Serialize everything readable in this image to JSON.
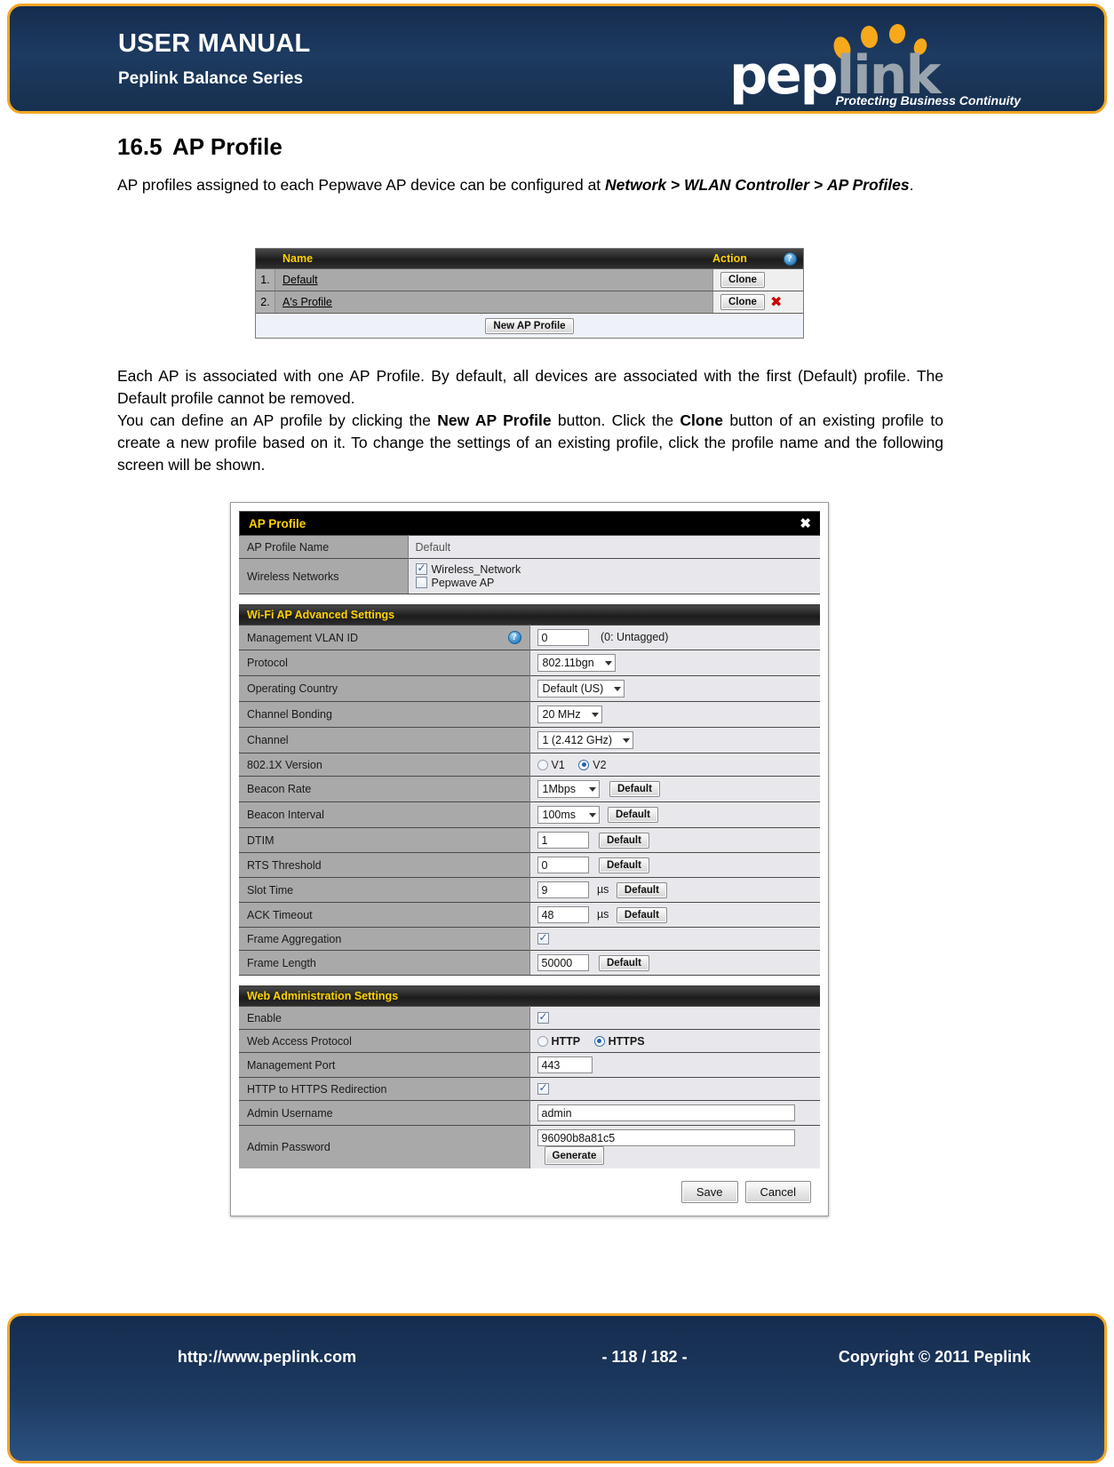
{
  "header": {
    "title": "USER MANUAL",
    "subtitle": "Peplink Balance Series",
    "logo_pep": "pep",
    "logo_link": "link",
    "tagline": "Protecting Business Continuity"
  },
  "section": {
    "number": "16.5",
    "heading": "AP Profile",
    "intro_pre": "AP profiles assigned to each Pepwave AP device can be configured at ",
    "intro_bold1": "Network > WLAN Controller >",
    "intro_bold2": "AP Profiles",
    "intro_post": ".",
    "para2": "Each AP is associated with one AP Profile.  By default, all devices are associated with the first (Default) profile. The Default profile cannot be removed.",
    "para3_a": "You can define an AP profile by clicking the ",
    "para3_b1": "New AP Profile",
    "para3_c": " button. Click the ",
    "para3_b2": "Clone",
    "para3_d": " button of an existing profile to create a new profile based on it. To change the settings of an existing profile, click the profile name and the following screen will be shown."
  },
  "profile_list": {
    "col_name": "Name",
    "col_action": "Action",
    "help_glyph": "?",
    "rows": [
      {
        "index": "1.",
        "name": "Default",
        "clone_label": "Clone",
        "deletable": false
      },
      {
        "index": "2.",
        "name": "A's Profile",
        "clone_label": "Clone",
        "deletable": true
      }
    ],
    "delete_glyph": "✖",
    "new_button": "New AP Profile"
  },
  "dialog": {
    "title": "AP Profile",
    "close_glyph": "✖",
    "profile_name_label": "AP Profile Name",
    "profile_name_value": "Default",
    "wireless_networks_label": "Wireless Networks",
    "wireless_networks": [
      {
        "label": "Wireless_Network",
        "checked": true
      },
      {
        "label": "Pepwave AP",
        "checked": false
      }
    ],
    "wifi_group_title": "Wi-Fi AP Advanced Settings",
    "wifi": {
      "vlan_label": "Management VLAN ID",
      "vlan_help": "?",
      "vlan_value": "0",
      "vlan_hint": "(0: Untagged)",
      "protocol_label": "Protocol",
      "protocol_value": "802.11bgn",
      "country_label": "Operating Country",
      "country_value": "Default (US)",
      "bonding_label": "Channel Bonding",
      "bonding_value": "20 MHz",
      "channel_label": "Channel",
      "channel_value": "1 (2.412 GHz)",
      "dot1x_label": "802.1X Version",
      "dot1x_v1": "V1",
      "dot1x_v2": "V2",
      "dot1x_selected": "V2",
      "beacon_rate_label": "Beacon Rate",
      "beacon_rate_value": "1Mbps",
      "beacon_interval_label": "Beacon Interval",
      "beacon_interval_value": "100ms",
      "dtim_label": "DTIM",
      "dtim_value": "1",
      "rts_label": "RTS Threshold",
      "rts_value": "0",
      "slot_time_label": "Slot Time",
      "slot_time_value": "9",
      "slot_time_unit": "µs",
      "ack_timeout_label": "ACK Timeout",
      "ack_timeout_value": "48",
      "ack_timeout_unit": "µs",
      "frame_agg_label": "Frame Aggregation",
      "frame_agg_checked": true,
      "frame_len_label": "Frame Length",
      "frame_len_value": "50000",
      "default_button": "Default"
    },
    "web_group_title": "Web Administration Settings",
    "web": {
      "enable_label": "Enable",
      "enable_checked": true,
      "protocol_label": "Web Access Protocol",
      "protocol_http": "HTTP",
      "protocol_https": "HTTPS",
      "protocol_selected": "HTTPS",
      "port_label": "Management Port",
      "port_value": "443",
      "redirect_label": "HTTP to HTTPS Redirection",
      "redirect_checked": true,
      "username_label": "Admin Username",
      "username_value": "admin",
      "password_label": "Admin Password",
      "password_value": "96090b8a81c5",
      "generate_button": "Generate"
    },
    "save_button": "Save",
    "cancel_button": "Cancel"
  },
  "footer": {
    "url": "http://www.peplink.com",
    "page": "- 118 / 182 -",
    "copyright": "Copyright © 2011 Peplink"
  }
}
